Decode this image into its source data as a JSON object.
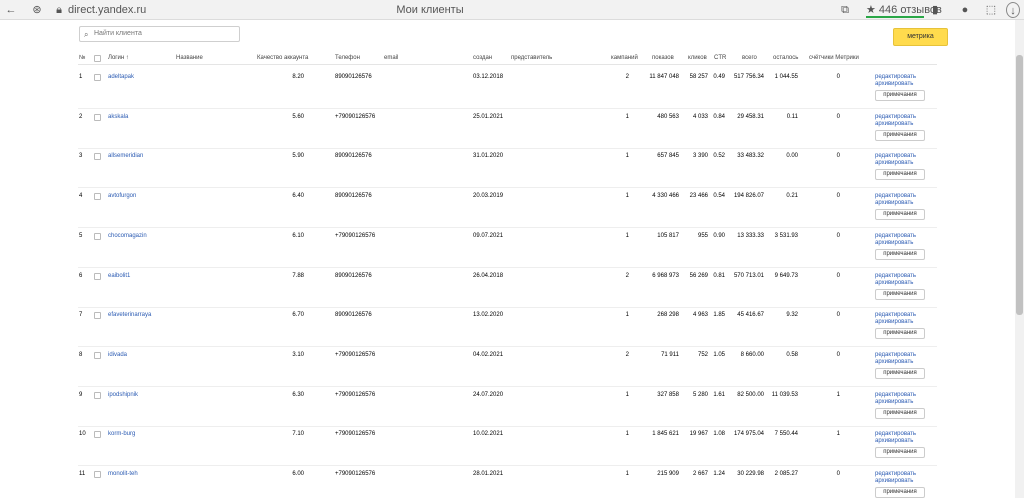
{
  "browser": {
    "url": "direct.yandex.ru",
    "title": "Мои клиенты",
    "reviews": "★ 446 отзывов",
    "icons": [
      "back-icon",
      "shield-icon",
      "lock-icon",
      "tabs-icon",
      "bookmark-icon",
      "account-icon",
      "extension-icon",
      "download-icon"
    ]
  },
  "search": {
    "placeholder": "Найти клиента"
  },
  "metrika_label": "метрика",
  "headers": {
    "num": "№",
    "login": "Логин ↑",
    "name": "Название",
    "quality": "Качество аккаунта",
    "phone": "Телефон",
    "email": "email",
    "created": "создан",
    "rep": "представитель",
    "camp": "кампаний",
    "shows": "показов",
    "clicks": "кликов",
    "ctr": "CTR",
    "total": "всего",
    "left": "осталось",
    "counters": "счётчики Метрики"
  },
  "actions": {
    "edit": "редактировать",
    "archive": "архивировать",
    "notes": "примечания"
  },
  "rows": [
    {
      "num": "1",
      "login": "adeltapak",
      "quality": "8.20",
      "phone": "89090126576",
      "created": "03.12.2018",
      "camp": "2",
      "shows": "11 847 048",
      "clicks": "58 257",
      "ctr": "0.49",
      "total": "517 756.34",
      "left": "1 044.55",
      "counters": "0"
    },
    {
      "num": "2",
      "login": "akskala",
      "quality": "5.60",
      "phone": "+79090126576",
      "created": "25.01.2021",
      "camp": "1",
      "shows": "480 563",
      "clicks": "4 033",
      "ctr": "0.84",
      "total": "29 458.31",
      "left": "0.11",
      "counters": "0"
    },
    {
      "num": "3",
      "login": "allsemeridian",
      "quality": "5.90",
      "phone": "89090126576",
      "created": "31.01.2020",
      "camp": "1",
      "shows": "657 845",
      "clicks": "3 390",
      "ctr": "0.52",
      "total": "33 483.32",
      "left": "0.00",
      "counters": "0"
    },
    {
      "num": "4",
      "login": "avtofurgon",
      "quality": "6.40",
      "phone": "89090126576",
      "created": "20.03.2019",
      "camp": "1",
      "shows": "4 330 466",
      "clicks": "23 466",
      "ctr": "0.54",
      "total": "194 826.07",
      "left": "0.21",
      "counters": "0"
    },
    {
      "num": "5",
      "login": "chocomagazin",
      "quality": "6.10",
      "phone": "+79090126576",
      "created": "09.07.2021",
      "camp": "1",
      "shows": "105 817",
      "clicks": "955",
      "ctr": "0.90",
      "total": "13 333.33",
      "left": "3 531.93",
      "counters": "0"
    },
    {
      "num": "6",
      "login": "eaibolit1",
      "quality": "7.88",
      "phone": "89090126576",
      "created": "26.04.2018",
      "camp": "2",
      "shows": "6 968 973",
      "clicks": "56 269",
      "ctr": "0.81",
      "total": "570 713.01",
      "left": "9 649.73",
      "counters": "0"
    },
    {
      "num": "7",
      "login": "efaveterinarraya",
      "quality": "6.70",
      "phone": "89090126576",
      "created": "13.02.2020",
      "camp": "1",
      "shows": "268 298",
      "clicks": "4 963",
      "ctr": "1.85",
      "total": "45 416.67",
      "left": "9.32",
      "counters": "0"
    },
    {
      "num": "8",
      "login": "idivada",
      "quality": "3.10",
      "phone": "+79090126576",
      "created": "04.02.2021",
      "camp": "2",
      "shows": "71 911",
      "clicks": "752",
      "ctr": "1.05",
      "total": "8 660.00",
      "left": "0.58",
      "counters": "0"
    },
    {
      "num": "9",
      "login": "ipodshipnik",
      "quality": "6.30",
      "phone": "+79090126576",
      "created": "24.07.2020",
      "camp": "1",
      "shows": "327 858",
      "clicks": "5 280",
      "ctr": "1.61",
      "total": "82 500.00",
      "left": "11 039.53",
      "counters": "1"
    },
    {
      "num": "10",
      "login": "korm-burg",
      "quality": "7.10",
      "phone": "+79090126576",
      "created": "10.02.2021",
      "camp": "1",
      "shows": "1 845 621",
      "clicks": "19 967",
      "ctr": "1.08",
      "total": "174 975.04",
      "left": "7 550.44",
      "counters": "1"
    },
    {
      "num": "11",
      "login": "monolit-teh",
      "quality": "6.00",
      "phone": "+79090126576",
      "created": "28.01.2021",
      "camp": "1",
      "shows": "215 909",
      "clicks": "2 667",
      "ctr": "1.24",
      "total": "30 229.98",
      "left": "2 085.27",
      "counters": "0"
    }
  ]
}
